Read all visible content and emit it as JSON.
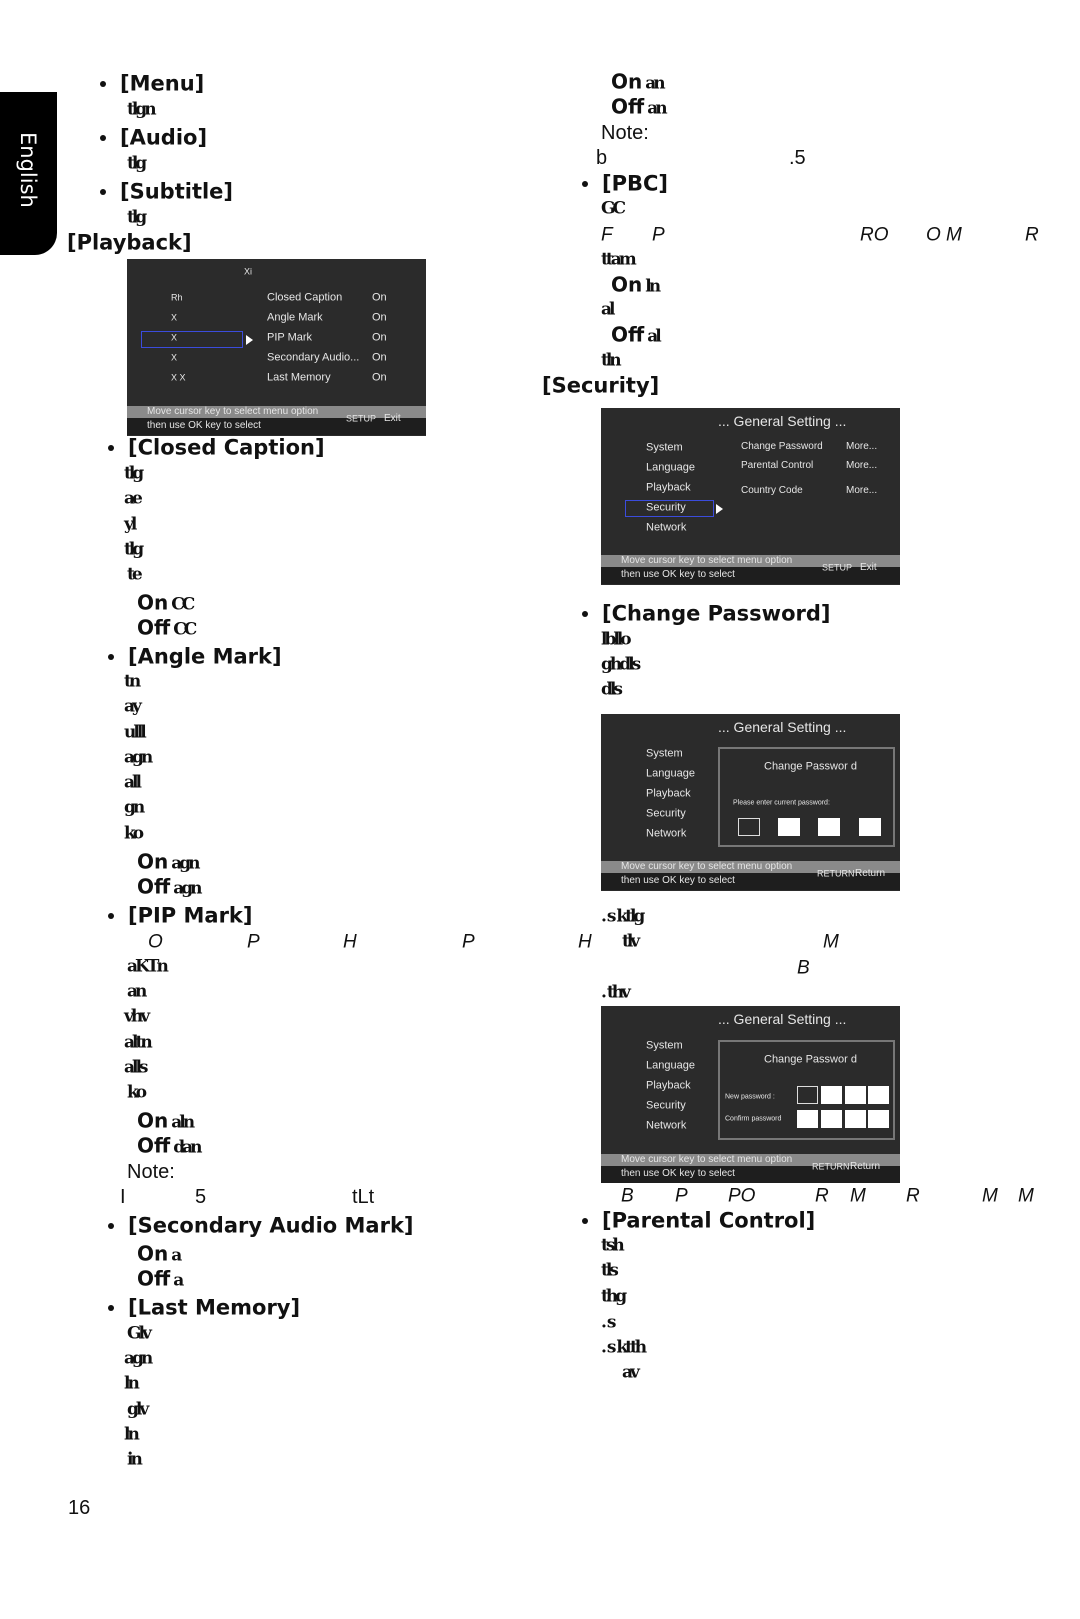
{
  "sidebar_tab": "English",
  "page_number": "16",
  "left_column": [
    {
      "kind": "bullet-head",
      "text": "[Menu]"
    },
    {
      "kind": "garb",
      "text": "tlgn"
    },
    {
      "kind": "bullet-head",
      "text": "[Audio]"
    },
    {
      "kind": "garb",
      "text": "tlg"
    },
    {
      "kind": "bullet-head",
      "text": "[Subtitle]"
    },
    {
      "kind": "garb",
      "text": "tlg"
    },
    {
      "kind": "head",
      "text": "[Playback]"
    },
    {
      "kind": "bullet-head",
      "text": "[Closed Caption]"
    },
    {
      "kind": "garb",
      "text": "tlg"
    },
    {
      "kind": "garb",
      "text": "ae"
    },
    {
      "kind": "garb",
      "text": "yl"
    },
    {
      "kind": "garb",
      "text": "tlg"
    },
    {
      "kind": "garb",
      "text": "te"
    },
    {
      "kind": "onoff",
      "text": "On",
      "tail": "CC"
    },
    {
      "kind": "onoff",
      "text": "Off",
      "tail": "CC"
    },
    {
      "kind": "bullet-head",
      "text": "[Angle Mark]"
    },
    {
      "kind": "garb",
      "text": "tn"
    },
    {
      "kind": "garb",
      "text": "ay"
    },
    {
      "kind": "garb",
      "text": "ulll"
    },
    {
      "kind": "garb",
      "text": "agn"
    },
    {
      "kind": "garb",
      "text": "all"
    },
    {
      "kind": "garb",
      "text": "gn"
    },
    {
      "kind": "garb",
      "text": "ko"
    },
    {
      "kind": "onoff",
      "text": "On",
      "tail": "agn"
    },
    {
      "kind": "onoff",
      "text": "Off",
      "tail": "agn"
    },
    {
      "kind": "bullet-head",
      "text": "[PIP Mark]"
    },
    {
      "kind": "garb",
      "text": "aKTn"
    },
    {
      "kind": "garb",
      "text": "an"
    },
    {
      "kind": "garb",
      "text": "vhv"
    },
    {
      "kind": "garb",
      "text": "altn"
    },
    {
      "kind": "garb",
      "text": "alls"
    },
    {
      "kind": "garb",
      "text": "ko"
    },
    {
      "kind": "onoff",
      "text": "On",
      "tail": "aln"
    },
    {
      "kind": "onoff",
      "text": "Off",
      "tail": "dan"
    },
    {
      "kind": "note",
      "text": "Note:"
    },
    {
      "kind": "bullet-head",
      "text": "[Secondary Audio Mark]"
    },
    {
      "kind": "onoff",
      "text": "On",
      "tail": "a"
    },
    {
      "kind": "onoff",
      "text": "Off",
      "tail": "a"
    },
    {
      "kind": "bullet-head",
      "text": "[Last Memory]"
    },
    {
      "kind": "garb",
      "text": "Glv"
    },
    {
      "kind": "garb",
      "text": "agn"
    },
    {
      "kind": "garb",
      "text": "ln"
    },
    {
      "kind": "garb",
      "text": "glv"
    },
    {
      "kind": "garb",
      "text": "ln"
    },
    {
      "kind": "garb",
      "text": "in"
    }
  ],
  "right_column": [
    {
      "kind": "onoff",
      "text": "On",
      "tail": "an"
    },
    {
      "kind": "onoff",
      "text": "Off",
      "tail": "an"
    },
    {
      "kind": "note",
      "text": "Note:"
    },
    {
      "kind": "bullet-head",
      "text": "[PBC]"
    },
    {
      "kind": "garb",
      "text": "GC"
    },
    {
      "kind": "garb",
      "text": "ttam"
    },
    {
      "kind": "onoff",
      "text": "On",
      "tail": "ln"
    },
    {
      "kind": "garb",
      "text": "al"
    },
    {
      "kind": "onoff",
      "text": "Off",
      "tail": "al"
    },
    {
      "kind": "garb",
      "text": "tln"
    },
    {
      "kind": "head",
      "text": "[Security]"
    },
    {
      "kind": "bullet-head",
      "text": "[Change Password]"
    },
    {
      "kind": "garb",
      "text": "lbllo"
    },
    {
      "kind": "garb",
      "text": "ghdls"
    },
    {
      "kind": "garb",
      "text": "dls"
    },
    {
      "kind": "garb",
      "text": ". s ktlg"
    },
    {
      "kind": "garb",
      "text": ". thv"
    },
    {
      "kind": "bullet-head",
      "text": "[Parental Control]"
    },
    {
      "kind": "garb",
      "text": "tsh"
    },
    {
      "kind": "garb",
      "text": "tls"
    },
    {
      "kind": "garb",
      "text": "thg"
    },
    {
      "kind": "garb",
      "text": ". s"
    },
    {
      "kind": "garb",
      "text": ". s ktth"
    },
    {
      "kind": "garb",
      "text": "av"
    }
  ],
  "fragments": [
    {
      "kind": "plain",
      "text": "I"
    },
    {
      "kind": "plain",
      "text": "5"
    },
    {
      "kind": "plain",
      "text": "tLt"
    },
    {
      "kind": "plain",
      "text": "b"
    },
    {
      "kind": "plain",
      "text": ".5"
    },
    {
      "kind": "ital",
      "text": "O"
    },
    {
      "kind": "ital",
      "text": "P"
    },
    {
      "kind": "ital",
      "text": "H"
    },
    {
      "kind": "ital",
      "text": "P"
    },
    {
      "kind": "ital",
      "text": "H"
    },
    {
      "kind": "garb",
      "text": "tlv"
    },
    {
      "kind": "ital",
      "text": "M"
    },
    {
      "kind": "ital",
      "text": "B"
    },
    {
      "kind": "ital",
      "text": "F"
    },
    {
      "kind": "ital",
      "text": "P"
    },
    {
      "kind": "ital",
      "text": "RO"
    },
    {
      "kind": "ital",
      "text": "O M"
    },
    {
      "kind": "ital",
      "text": "R"
    },
    {
      "kind": "ital",
      "text": "B"
    },
    {
      "kind": "ital",
      "text": "P"
    },
    {
      "kind": "ital",
      "text": "PO"
    },
    {
      "kind": "ital",
      "text": "R"
    },
    {
      "kind": "ital",
      "text": "M"
    },
    {
      "kind": "ital",
      "text": "R"
    },
    {
      "kind": "ital",
      "text": "M"
    },
    {
      "kind": "ital",
      "text": "M"
    }
  ],
  "screens": {
    "playback": {
      "title": "Xi",
      "menu": [
        "Rh",
        "X",
        "X",
        "X",
        "X   X"
      ],
      "options": [
        {
          "label": "Closed Caption",
          "value": "On"
        },
        {
          "label": "Angle Mark",
          "value": "On"
        },
        {
          "label": "PIP Mark",
          "value": "On"
        },
        {
          "label": "Secondary Audio...",
          "value": "On"
        },
        {
          "label": "Last Memory",
          "value": "On"
        }
      ],
      "footer_line1": "Move cursor key to select menu option",
      "footer_line2": "then use  OK  key to select",
      "footer_key": "SETUP",
      "footer_action": "Exit"
    },
    "security": {
      "title": "... General Setting ...",
      "menu": [
        "System",
        "Language",
        "Playback",
        "Security",
        "Network"
      ],
      "options": [
        {
          "label": "Change Password",
          "value": "More..."
        },
        {
          "label": "Parental Control",
          "value": "More..."
        },
        {
          "label": "Country Code",
          "value": "More..."
        }
      ],
      "footer_line1": "Move cursor key to select menu option",
      "footer_line2": "then use  OK  key to select",
      "footer_key": "SETUP",
      "footer_action": "Exit"
    },
    "change_current": {
      "title": "... General Setting ...",
      "menu": [
        "System",
        "Language",
        "Playback",
        "Security",
        "Network"
      ],
      "dialog_title": "Change Passwor d",
      "prompt": "Please enter current password:",
      "footer_line1": "Move cursor key to select menu option",
      "footer_line2": "then use  OK  key to select",
      "footer_key": "RETURN",
      "footer_action": "Return"
    },
    "change_new": {
      "title": "... General Setting ...",
      "menu": [
        "System",
        "Language",
        "Playback",
        "Security",
        "Network"
      ],
      "dialog_title": "Change Passwor d",
      "new_label": "New password   :",
      "confirm_label": "Confirm password",
      "footer_line1": "Move cursor key to select menu option",
      "footer_line2": "then use  OK  key to select",
      "footer_key": "RETURN",
      "footer_action": "Return"
    }
  },
  "colors": {
    "selection": "#3b4cdc",
    "screen_bg": "#2b2b2b",
    "footer_bar": "#8a8a8a"
  }
}
